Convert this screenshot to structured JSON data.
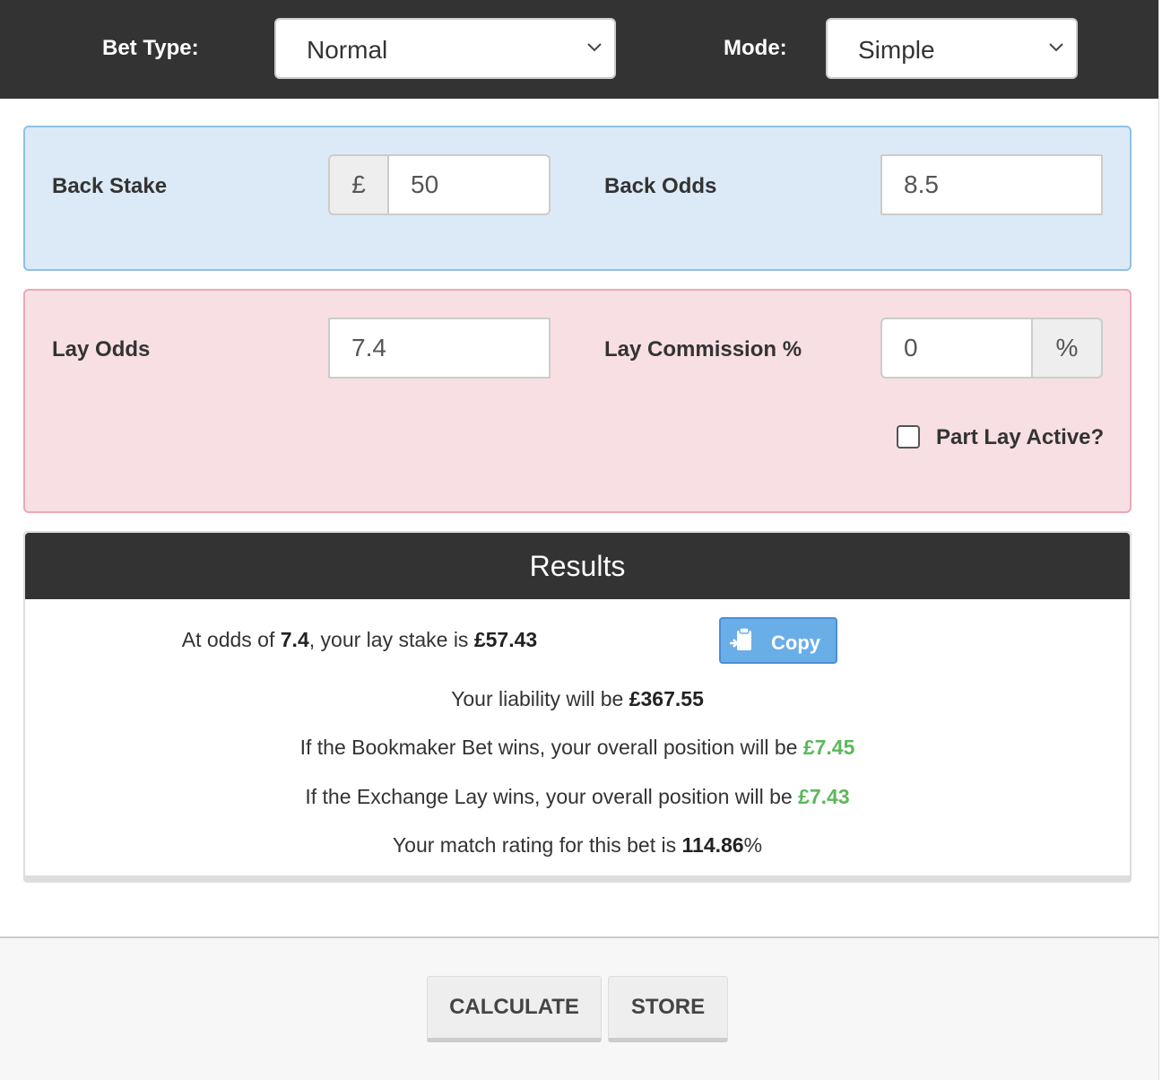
{
  "header": {
    "bet_type_label": "Bet Type:",
    "bet_type_value": "Normal",
    "mode_label": "Mode:",
    "mode_value": "Simple"
  },
  "back": {
    "stake_label": "Back Stake",
    "currency_symbol": "£",
    "stake_value": "50",
    "odds_label": "Back Odds",
    "odds_value": "8.5"
  },
  "lay": {
    "odds_label": "Lay Odds",
    "odds_value": "7.4",
    "commission_label": "Lay Commission %",
    "commission_value": "0",
    "percent_symbol": "%",
    "part_lay_label": "Part Lay Active?",
    "part_lay_checked": false
  },
  "results": {
    "title": "Results",
    "line1_prefix": "At odds of ",
    "line1_odds": "7.4",
    "line1_mid": ", your lay stake is ",
    "line1_stake": "£57.43",
    "copy_label": "Copy",
    "line2_prefix": "Your liability will be ",
    "line2_value": "£367.55",
    "line3_prefix": "If the Bookmaker Bet wins, your overall position will be ",
    "line3_value": "£7.45",
    "line4_prefix": "If the Exchange Lay wins, your overall position will be ",
    "line4_value": "£7.43",
    "line5_prefix": "Your match rating for this bet is ",
    "line5_value": "114.86",
    "line5_suffix": "%"
  },
  "footer": {
    "calculate_label": "CALCULATE",
    "store_label": "STORE"
  },
  "colors": {
    "header_bg": "#333333",
    "back_panel_bg": "#dbeaf6",
    "lay_panel_bg": "#f7dfe4",
    "positive": "#5cb85c",
    "copy_button": "#6aaee8"
  },
  "icons": [
    "chevron-down-icon",
    "clipboard-copy-icon"
  ]
}
